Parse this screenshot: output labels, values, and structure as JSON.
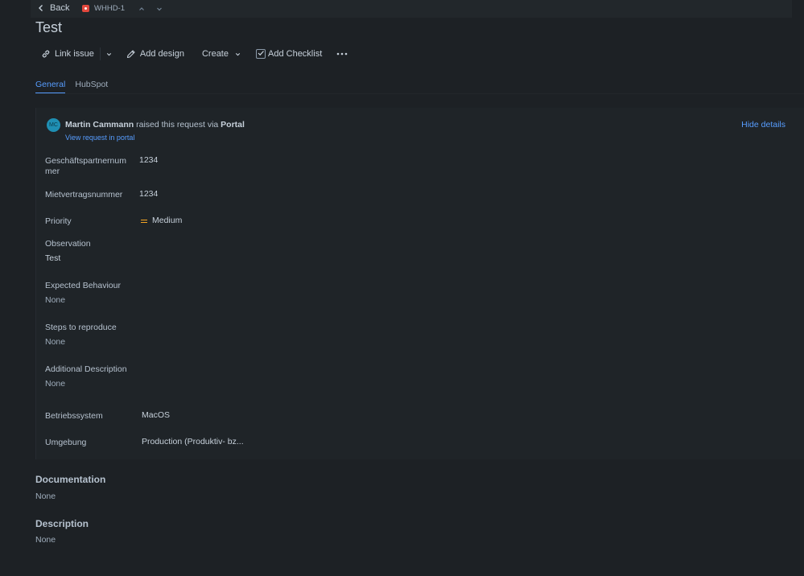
{
  "topbar": {
    "back_label": "Back",
    "issue_key": "WHHD-1",
    "icons": [
      "chevron-left-icon",
      "issue-type-icon",
      "chevron-up-icon",
      "chevron-down-icon"
    ]
  },
  "title": "Test",
  "toolbar": {
    "link_issue": "Link issue",
    "add_design": "Add design",
    "create": "Create",
    "add_checklist": "Add Checklist"
  },
  "tabs": [
    {
      "label": "General",
      "active": true
    },
    {
      "label": "HubSpot",
      "active": false
    }
  ],
  "request": {
    "avatar_initials": "MC",
    "requester": "Martin Cammann",
    "raised_text": "raised this request via",
    "channel": "Portal",
    "view_link": "View request in portal",
    "hide_details": "Hide details"
  },
  "fields": {
    "partner_label_1": "Geschäftspartnernum",
    "partner_label_2": "mer",
    "partner_value": "1234",
    "contract_label": "Mietvertragsnummer",
    "contract_value": "1234",
    "priority_label": "Priority",
    "priority_value": "Medium",
    "observation_label": "Observation",
    "observation_value": "Test",
    "expected_label": "Expected Behaviour",
    "expected_value": "None",
    "steps_label": "Steps to reproduce",
    "steps_value": "None",
    "additional_label": "Additional Description",
    "additional_value": "None",
    "os_label": "Betriebssystem",
    "os_value": "MacOS",
    "env_label": "Umgebung",
    "env_value": "Production (Produktiv- bz..."
  },
  "documentation": {
    "heading": "Documentation",
    "value": "None"
  },
  "description": {
    "heading": "Description",
    "value": "None"
  },
  "colors": {
    "accent": "#579dff",
    "background": "#1d2125",
    "priority_medium": "#f5a623",
    "avatar": "#1f8fb3"
  }
}
